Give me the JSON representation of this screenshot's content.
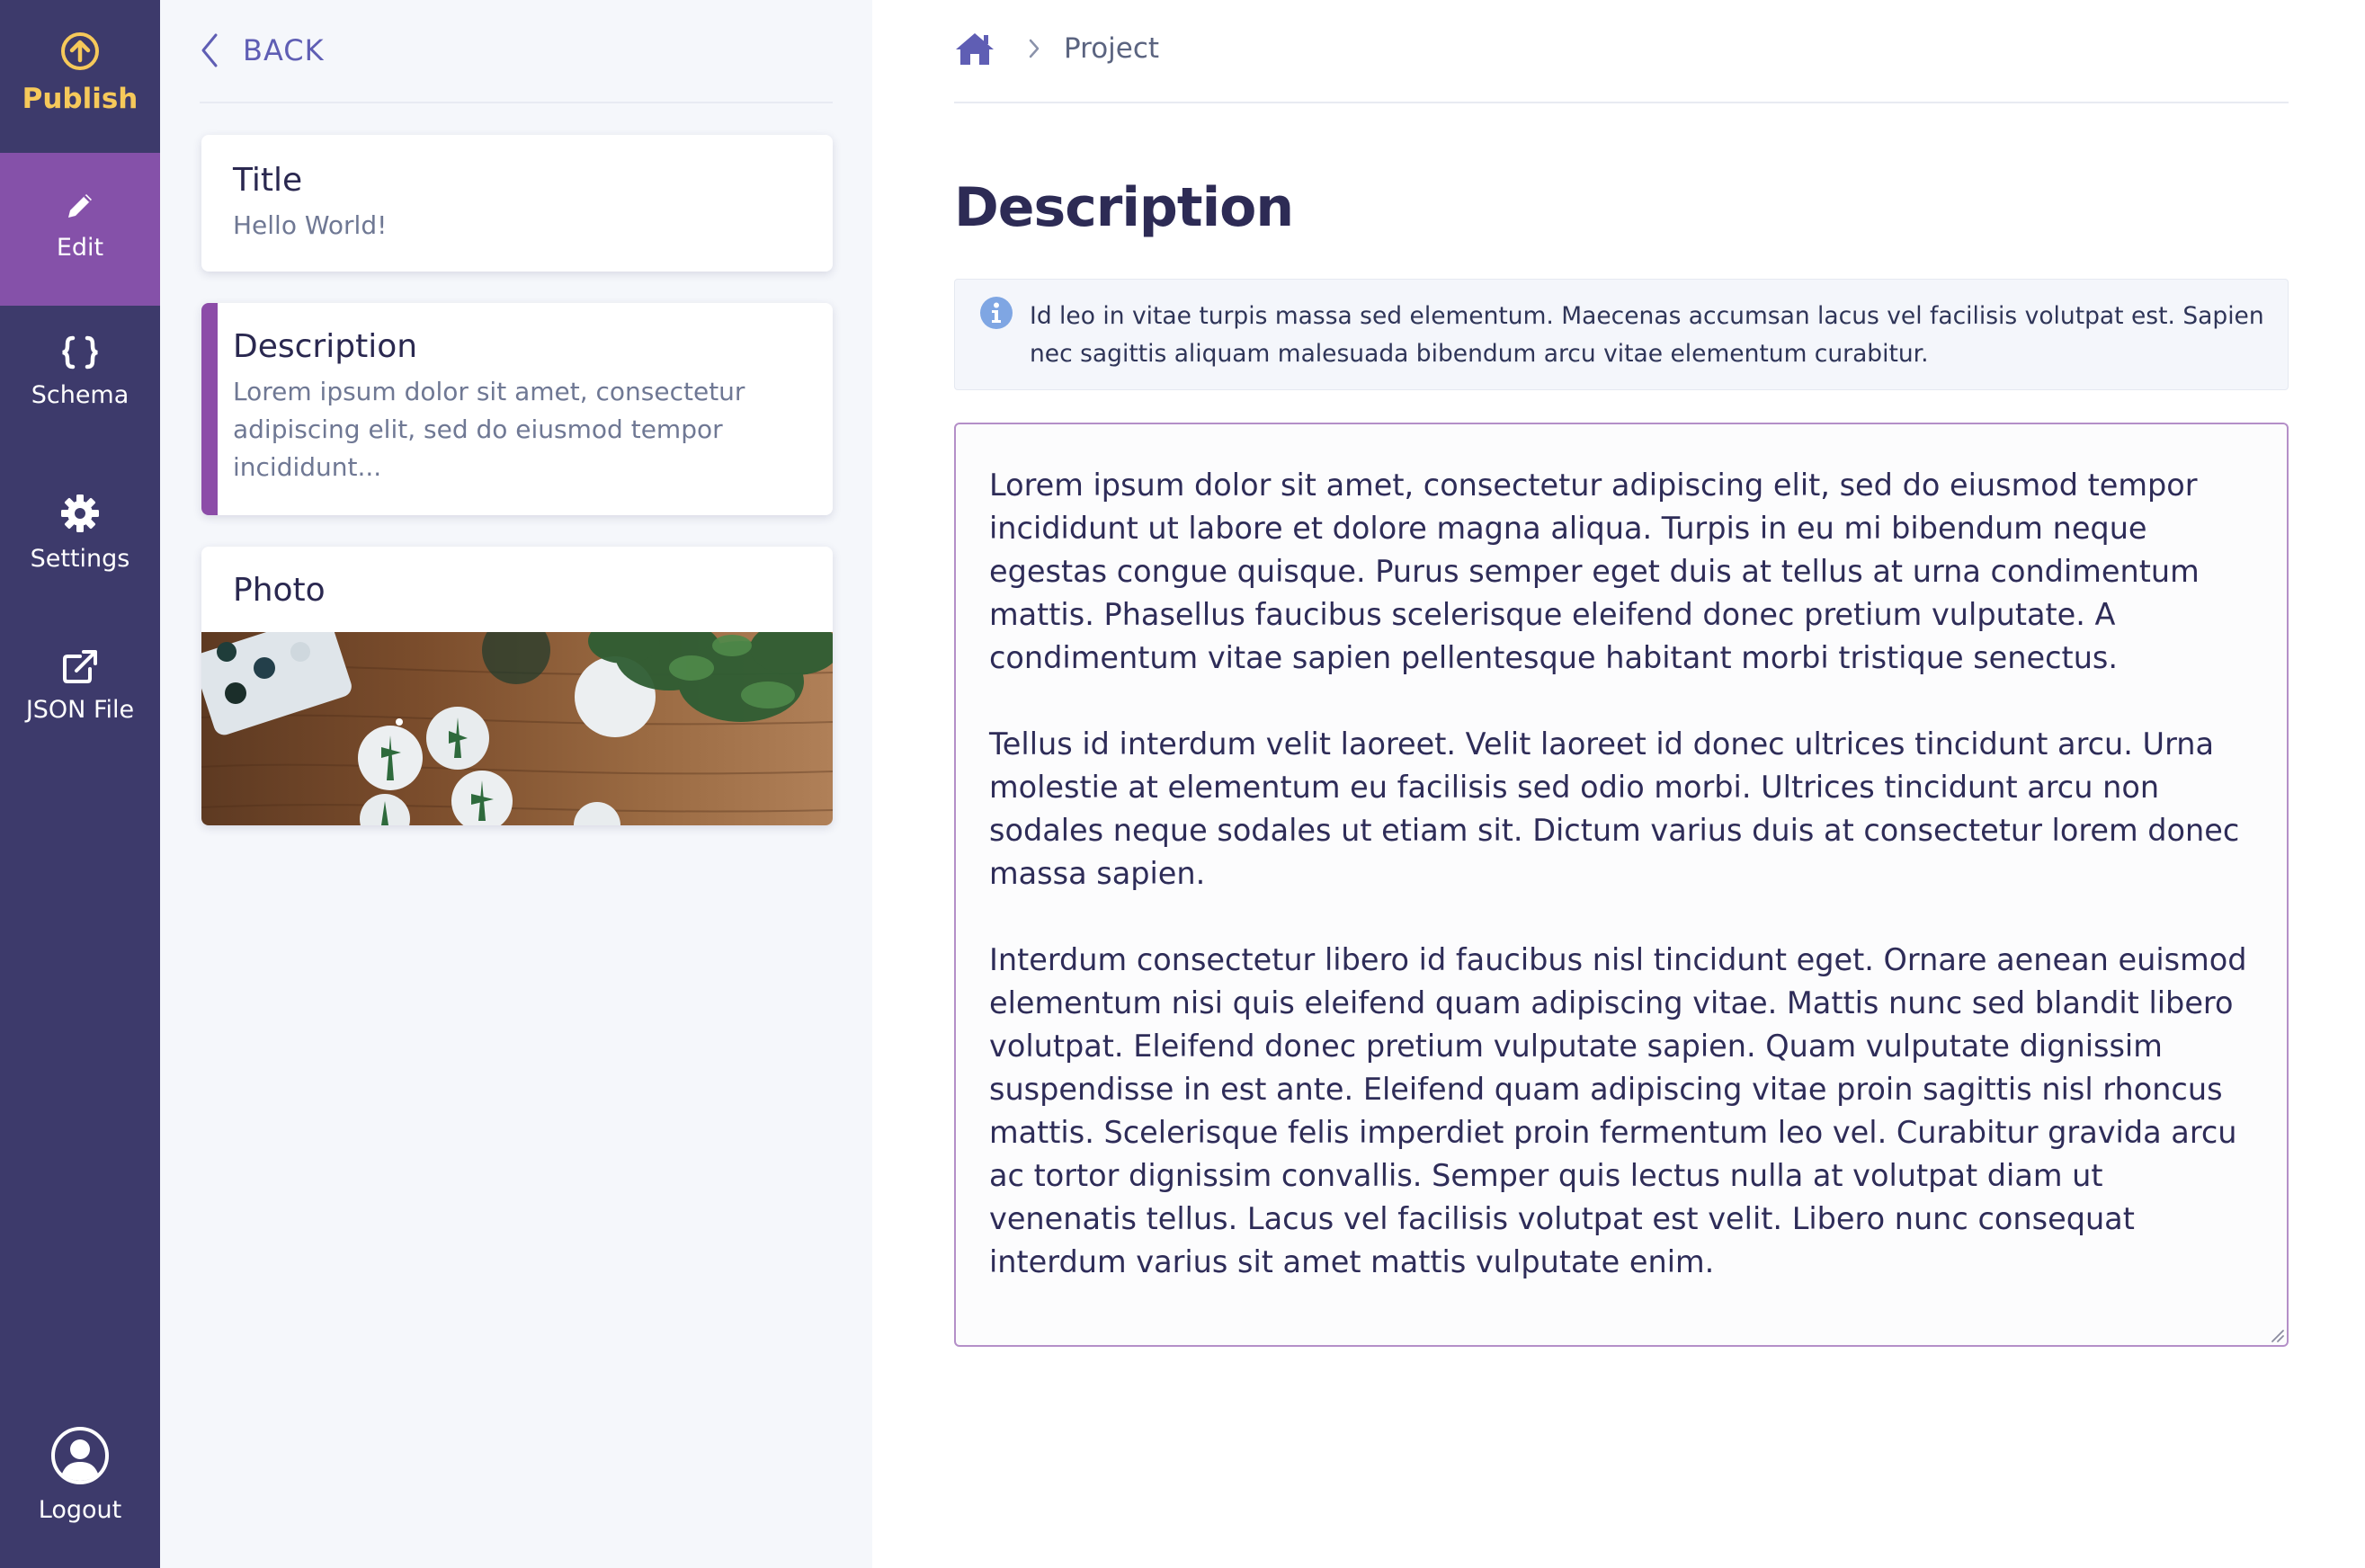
{
  "rail": {
    "publish_label": "Publish",
    "edit_label": "Edit",
    "schema_label": "Schema",
    "settings_label": "Settings",
    "json_label": "JSON File",
    "logout_label": "Logout",
    "colors": {
      "background": "#3d3a6b",
      "active": "#8551a9",
      "publish": "#f6c95a"
    }
  },
  "cards_panel": {
    "back_label": "BACK",
    "cards": [
      {
        "title": "Title",
        "value": "Hello World!"
      },
      {
        "title": "Description",
        "value": "Lorem ipsum dolor sit amet, consectetur adipiscing elit, sed do eiusmod tempor incididunt..."
      },
      {
        "title": "Photo",
        "image": "wooden-table-with-plant-prints"
      }
    ],
    "accent_color": "#8c4ca8"
  },
  "main": {
    "breadcrumb": {
      "home_icon": "home-icon",
      "current": "Project"
    },
    "page_title": "Description",
    "info_text": "Id leo in vitae turpis massa sed elementum. Maecenas accumsan lacus vel facilisis volutpat est. Sapien nec sagittis aliquam malesuada bibendum arcu vitae elementum curabitur.",
    "editor_paragraphs": [
      "Lorem ipsum dolor sit amet, consectetur adipiscing elit, sed do eiusmod tempor incididunt ut labore et dolore magna aliqua. Turpis in eu mi bibendum neque egestas congue quisque. Purus semper eget duis at tellus at urna condimentum mattis. Phasellus faucibus scelerisque eleifend donec pretium vulputate. A condimentum vitae sapien pellentesque habitant morbi tristique senectus.",
      "Tellus id interdum velit laoreet. Velit laoreet id donec ultrices tincidunt arcu. Urna molestie at elementum eu facilisis sed odio morbi. Ultrices tincidunt arcu non sodales neque sodales ut etiam sit. Dictum varius duis at consectetur lorem donec massa sapien.",
      "Interdum consectetur libero id faucibus nisl tincidunt eget. Ornare aenean euismod elementum nisi quis eleifend quam adipiscing vitae. Mattis nunc sed blandit libero volutpat. Eleifend donec pretium vulputate sapien. Quam vulputate dignissim suspendisse in est ante. Eleifend quam adipiscing vitae proin sagittis nisl rhoncus mattis. Scelerisque felis imperdiet proin fermentum leo vel. Curabitur gravida arcu ac tortor dignissim convallis. Semper quis lectus nulla at volutpat diam ut venenatis tellus. Lacus vel facilisis volutpat est velit. Libero nunc consequat interdum varius sit amet mattis vulputate enim."
    ],
    "info_icon_color": "#7fa6e3",
    "editor_border_color": "#b48fc8"
  }
}
